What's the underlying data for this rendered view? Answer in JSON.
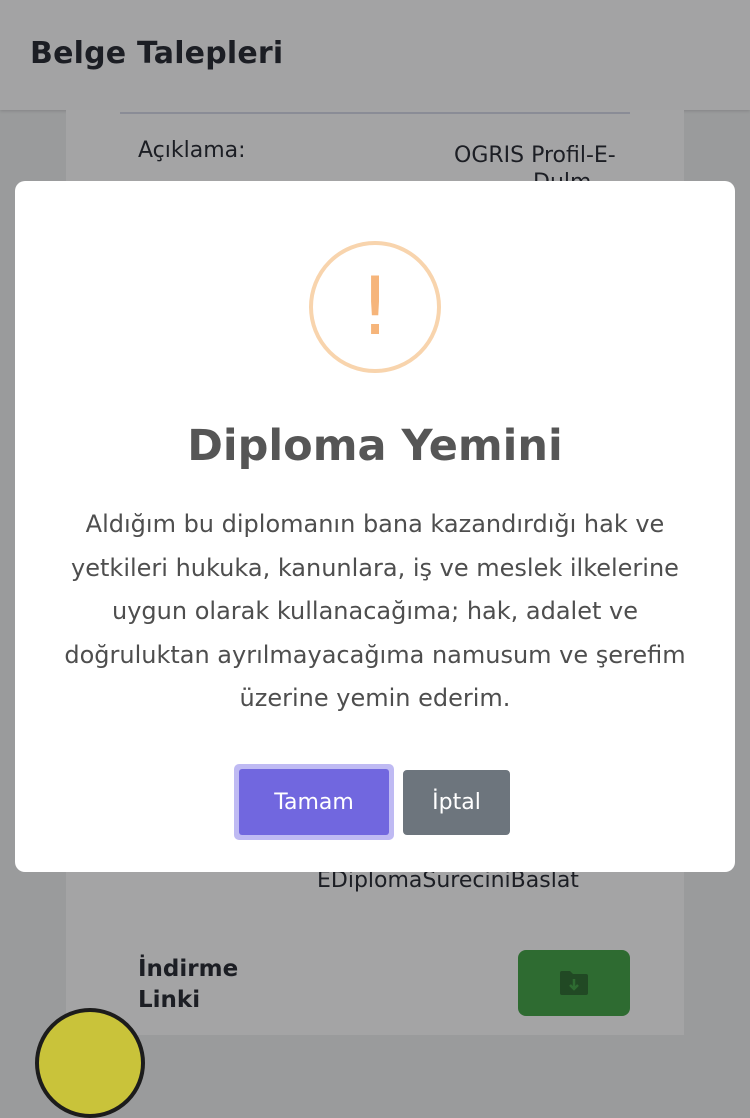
{
  "header": {
    "title": "Belge Talepleri"
  },
  "card": {
    "description_label": "Açıklama:",
    "description_value_line1": "OGRIS Profil-E-",
    "description_value_line2": "Dulm",
    "method_value": "EDiplomaSureciniBaslat",
    "download_label_line1": "İndirme",
    "download_label_line2": "Linki",
    "download_icon": "folder-download-icon",
    "download_color": "#2e6b31"
  },
  "modal": {
    "icon": "exclamation-warning-icon",
    "icon_color": "#f6b57b",
    "title": "Diploma Yemini",
    "text": "Aldığım bu diplomanın bana kazandırdığı hak ve yetkileri hukuka, kanunlara, iş ve meslek ilkelerine uygun olarak kullanacağıma; hak, adalet ve doğruluktan ayrılmayacağıma namusum ve şerefim üzerine yemin ederim.",
    "confirm_label": "Tamam",
    "confirm_color": "#7167df",
    "cancel_label": "İptal",
    "cancel_color": "#6d757d"
  }
}
